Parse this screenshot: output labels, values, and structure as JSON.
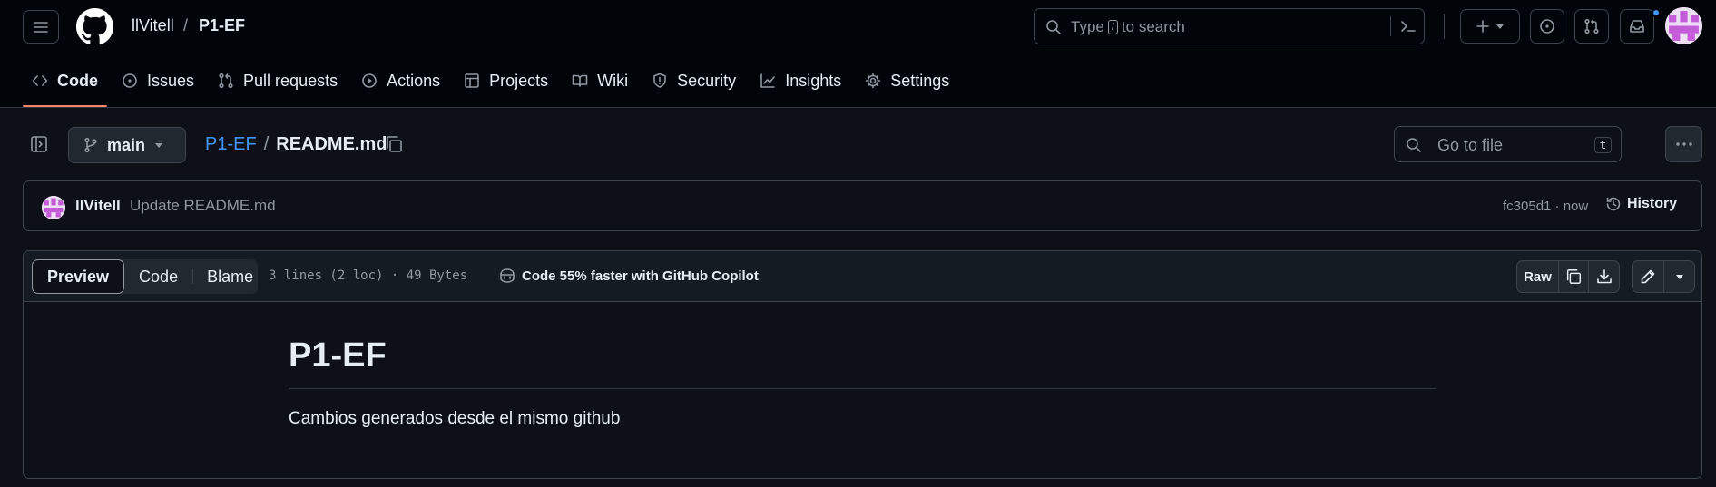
{
  "header": {
    "owner": "llVitell",
    "separator": "/",
    "repo": "P1-EF",
    "search_prefix": "Type",
    "search_key": "/",
    "search_suffix": "to search"
  },
  "nav": {
    "tabs": [
      {
        "label": "Code",
        "icon": "code-icon",
        "active": true
      },
      {
        "label": "Issues",
        "icon": "issue-icon"
      },
      {
        "label": "Pull requests",
        "icon": "pull-request-icon"
      },
      {
        "label": "Actions",
        "icon": "play-icon"
      },
      {
        "label": "Projects",
        "icon": "table-icon"
      },
      {
        "label": "Wiki",
        "icon": "book-icon"
      },
      {
        "label": "Security",
        "icon": "shield-icon"
      },
      {
        "label": "Insights",
        "icon": "graph-icon"
      },
      {
        "label": "Settings",
        "icon": "gear-icon"
      }
    ]
  },
  "file_bar": {
    "branch": "main",
    "repo_link": "P1-EF",
    "separator": "/",
    "file_name": "README.md",
    "goto_placeholder": "Go to file",
    "goto_key": "t"
  },
  "commit": {
    "author": "llVitell",
    "message": "Update README.md",
    "meta": "fc305d1 · now",
    "history_label": "History"
  },
  "file_view": {
    "modes": [
      "Preview",
      "Code",
      "Blame"
    ],
    "active_mode": "Preview",
    "info": "3 lines (2 loc) · 49 Bytes",
    "copilot_text": "Code 55% faster with GitHub Copilot",
    "raw_label": "Raw"
  },
  "readme": {
    "heading": "P1-EF",
    "paragraph": "Cambios generados desde el mismo github"
  },
  "colors": {
    "background": "#0d1117",
    "header_bg": "#010409",
    "link": "#4493f8",
    "active_tab_underline": "#f78166",
    "muted": "#9198a1"
  }
}
